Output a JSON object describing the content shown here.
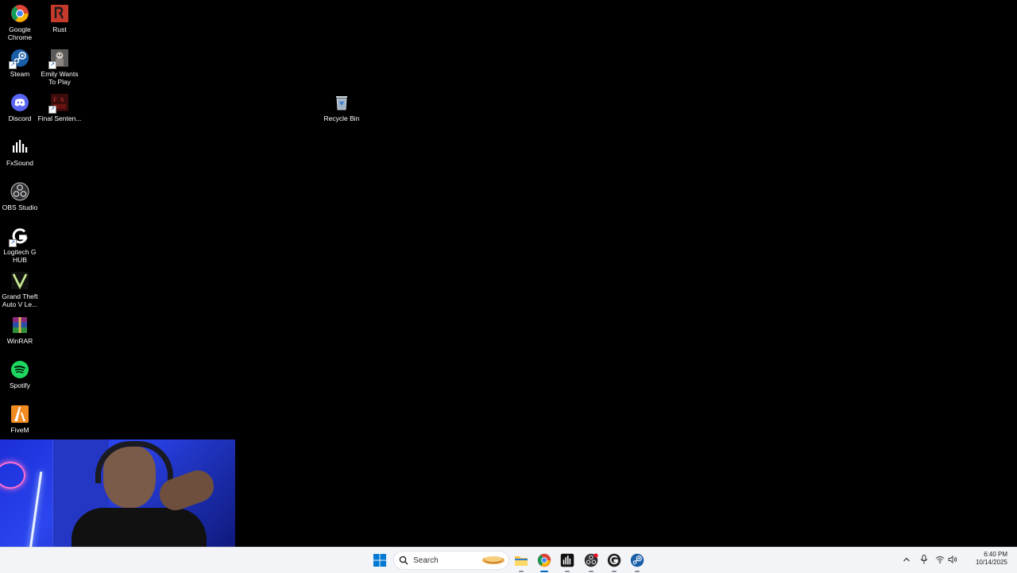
{
  "desktop": {
    "icons": [
      {
        "id": "chrome",
        "label": "Google Chrome",
        "icon": "chrome-icon"
      },
      {
        "id": "rust",
        "label": "Rust",
        "icon": "rust-icon"
      },
      {
        "id": "steam",
        "label": "Steam",
        "icon": "steam-icon"
      },
      {
        "id": "emily",
        "label": "Emily Wants To Play",
        "icon": "emily-wants-to-play-icon"
      },
      {
        "id": "discord",
        "label": "Discord",
        "icon": "discord-icon"
      },
      {
        "id": "final",
        "label": "Final Senten...",
        "icon": "final-sentence-icon"
      },
      {
        "id": "fxsound",
        "label": "FxSound",
        "icon": "fxsound-icon"
      },
      {
        "id": "obs",
        "label": "OBS Studio",
        "icon": "obs-studio-icon"
      },
      {
        "id": "logitech",
        "label": "Logitech G HUB",
        "icon": "logitech-g-hub-icon"
      },
      {
        "id": "gta",
        "label": "Grand Theft Auto V Le...",
        "icon": "gta-v-icon"
      },
      {
        "id": "winrar",
        "label": "WinRAR",
        "icon": "winrar-icon"
      },
      {
        "id": "spotify",
        "label": "Spotify",
        "icon": "spotify-icon"
      },
      {
        "id": "fivem",
        "label": "FiveM",
        "icon": "fivem-icon"
      },
      {
        "id": "recycle",
        "label": "Recycle Bin",
        "icon": "recycle-bin-icon"
      }
    ]
  },
  "taskbar": {
    "search_placeholder": "Search",
    "pinned": [
      "start-icon",
      "file-explorer-icon",
      "chrome-icon",
      "fxsound-icon",
      "obs-studio-icon",
      "logitech-g-hub-icon",
      "steam-icon"
    ],
    "clock_time": "6:40 PM",
    "clock_date": "10/14/2025"
  },
  "colors": {
    "desktop_bg": "#000000",
    "taskbar_bg": "#f2f4f8",
    "accent": "#0067c0"
  }
}
